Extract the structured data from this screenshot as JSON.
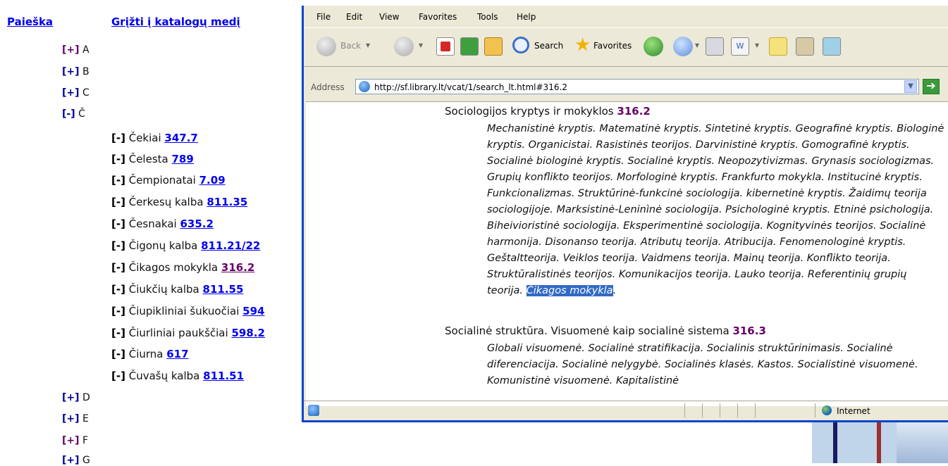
{
  "left_nav": {
    "search_link": "Paieška",
    "back_link": "Grįžti į katalogų medį"
  },
  "letters": [
    {
      "toggle": "[+]",
      "label": "A",
      "visited": true
    },
    {
      "toggle": "[+]",
      "label": "B",
      "visited": false
    },
    {
      "toggle": "[+]",
      "label": "C",
      "visited": false
    },
    {
      "toggle": "[-]",
      "label": "Č",
      "visited": false
    },
    {
      "toggle": "[+]",
      "label": "D",
      "visited": false
    },
    {
      "toggle": "[+]",
      "label": "E",
      "visited": false
    },
    {
      "toggle": "[+]",
      "label": "F",
      "visited": true
    },
    {
      "toggle": "[+]",
      "label": "G",
      "visited": false
    }
  ],
  "c_items": [
    {
      "toggle": "[-]",
      "label": "Čekiai",
      "code": "347.7"
    },
    {
      "toggle": "[-]",
      "label": "Čelesta",
      "code": "789"
    },
    {
      "toggle": "[-]",
      "label": "Čempionatai",
      "code": "7.09"
    },
    {
      "toggle": "[-]",
      "label": "Čerkesų kalba",
      "code": "811.35"
    },
    {
      "toggle": "[-]",
      "label": "Česnakai",
      "code": "635.2"
    },
    {
      "toggle": "[-]",
      "label": "Čigonų kalba",
      "code": "811.21/22"
    },
    {
      "toggle": "[-]",
      "label": "Čikagos mokykla",
      "code": "316.2"
    },
    {
      "toggle": "[-]",
      "label": "Čiukčių kalba",
      "code": "811.55"
    },
    {
      "toggle": "[-]",
      "label": "Čiupikliniai šukuočiai",
      "code": "594"
    },
    {
      "toggle": "[-]",
      "label": "Čiurliniai paukščiai",
      "code": "598.2"
    },
    {
      "toggle": "[-]",
      "label": "Čiurna",
      "code": "617"
    },
    {
      "toggle": "[-]",
      "label": "Čuvašų kalba",
      "code": "811.51"
    }
  ],
  "browser": {
    "menu": [
      "File",
      "Edit",
      "View",
      "Favorites",
      "Tools",
      "Help"
    ],
    "toolbar": {
      "back": "Back",
      "search": "Search",
      "favorites": "Favorites"
    },
    "address_label": "Address",
    "url": "http://sf.library.lt/vcat/1/search_lt.html#316.2",
    "status_zone": "Internet"
  },
  "content": {
    "section1_title": "Sociologijos kryptys ir mokyklos",
    "section1_code": "316.2",
    "section1_text": "Mechanistinė kryptis. Matematinė kryptis. Sintetinė kryptis. Geografinė kryptis. Biologinė kryptis. Organicistai. Rasistinės teorijos. Darvinistinė kryptis. Gomografinė kryptis. Socialinė biologinė kryptis. Socialinė kryptis. Neopozytivizmas. Grynasis sociologizmas. Grupių konflikto teorijos. Morfologinė kryptis. Frankfurto mokykla. Institucinė kryptis. Funkcionalizmas. Struktūrinė-funkcinė sociologija. kibernetinė kryptis. Žaidimų teorija sociologijoje. Marksistinė-Leninìnė sociologija. Psichologinė kryptis. Etninė psichologija. Biheivioristinė sociologija. Eksperimentinė sociologija. Kognityvinės teorijos. Socialinė harmonija. Disonanso teorija. Atributų teorija. Atribucija. Fenomenologinė kryptis. Geštaltteorija. Veiklos teorija. Vaidmens teorija. Mainų teorija. Konflikto teorija. Struktūralistinės teorijos. Komunikacijos teorija. Lauko teorija. Referentinių grupių teorija.",
    "section1_highlight": "Čikagos mokykla",
    "section2_title": "Socialinė struktūra. Visuomenė kaip socialinė sistema",
    "section2_code": "316.3",
    "section2_text": "Globali visuomenė. Socialinė stratifikacija. Socialinis struktūrinimasis. Socialinė diferenciacija. Socialinė nelygybė. Socialinės klasės. Kastos. Socialistinė visuomenė. Komunistinė visuomenė. Kapitalistinė"
  }
}
